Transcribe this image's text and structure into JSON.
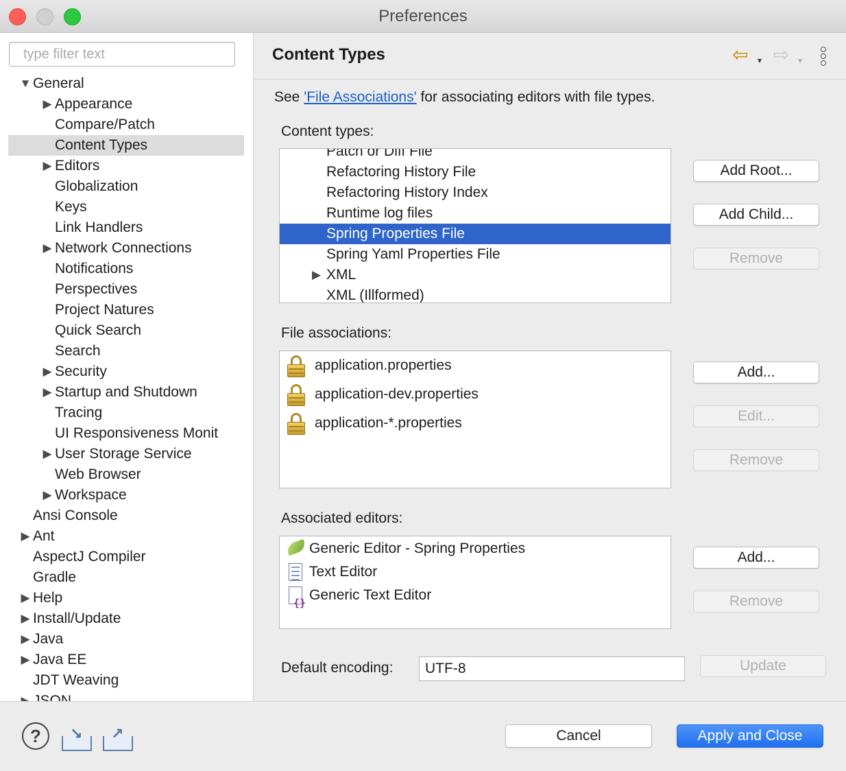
{
  "window": {
    "title": "Preferences"
  },
  "sidebar": {
    "filter_placeholder": "type filter text",
    "items": [
      {
        "label": "General",
        "level": 0,
        "twisty": "▼"
      },
      {
        "label": "Appearance",
        "level": 1,
        "twisty": "▶"
      },
      {
        "label": "Compare/Patch",
        "level": 1,
        "twisty": ""
      },
      {
        "label": "Content Types",
        "level": 1,
        "twisty": "",
        "selected": true
      },
      {
        "label": "Editors",
        "level": 1,
        "twisty": "▶"
      },
      {
        "label": "Globalization",
        "level": 1,
        "twisty": ""
      },
      {
        "label": "Keys",
        "level": 1,
        "twisty": ""
      },
      {
        "label": "Link Handlers",
        "level": 1,
        "twisty": ""
      },
      {
        "label": "Network Connections",
        "level": 1,
        "twisty": "▶"
      },
      {
        "label": "Notifications",
        "level": 1,
        "twisty": ""
      },
      {
        "label": "Perspectives",
        "level": 1,
        "twisty": ""
      },
      {
        "label": "Project Natures",
        "level": 1,
        "twisty": ""
      },
      {
        "label": "Quick Search",
        "level": 1,
        "twisty": ""
      },
      {
        "label": "Search",
        "level": 1,
        "twisty": ""
      },
      {
        "label": "Security",
        "level": 1,
        "twisty": "▶"
      },
      {
        "label": "Startup and Shutdown",
        "level": 1,
        "twisty": "▶"
      },
      {
        "label": "Tracing",
        "level": 1,
        "twisty": ""
      },
      {
        "label": "UI Responsiveness Monit",
        "level": 1,
        "twisty": ""
      },
      {
        "label": "User Storage Service",
        "level": 1,
        "twisty": "▶"
      },
      {
        "label": "Web Browser",
        "level": 1,
        "twisty": ""
      },
      {
        "label": "Workspace",
        "level": 1,
        "twisty": "▶"
      },
      {
        "label": "Ansi Console",
        "level": 0,
        "twisty": ""
      },
      {
        "label": "Ant",
        "level": 0,
        "twisty": "▶"
      },
      {
        "label": "AspectJ Compiler",
        "level": 0,
        "twisty": ""
      },
      {
        "label": "Gradle",
        "level": 0,
        "twisty": ""
      },
      {
        "label": "Help",
        "level": 0,
        "twisty": "▶"
      },
      {
        "label": "Install/Update",
        "level": 0,
        "twisty": "▶"
      },
      {
        "label": "Java",
        "level": 0,
        "twisty": "▶"
      },
      {
        "label": "Java EE",
        "level": 0,
        "twisty": "▶"
      },
      {
        "label": "JDT Weaving",
        "level": 0,
        "twisty": ""
      },
      {
        "label": "JSON",
        "level": 0,
        "twisty": "▶"
      }
    ]
  },
  "content": {
    "title": "Content Types",
    "nav": {
      "back_icon": "back-arrow-icon",
      "forward_icon": "forward-arrow-icon",
      "dropdown": "▾",
      "back_glyph": "⇦",
      "forward_glyph": "⇨"
    },
    "intro": {
      "before": "See ",
      "link": "'File Associations'",
      "after": " for associating editors with file types."
    },
    "content_types": {
      "label": "Content types:",
      "items": [
        {
          "label": "Patch or Diff File",
          "twisty": ""
        },
        {
          "label": "Refactoring History File",
          "twisty": ""
        },
        {
          "label": "Refactoring History Index",
          "twisty": ""
        },
        {
          "label": "Runtime log files",
          "twisty": ""
        },
        {
          "label": "Spring Properties File",
          "twisty": "",
          "selected": true
        },
        {
          "label": "Spring Yaml Properties File",
          "twisty": ""
        },
        {
          "label": "XML",
          "twisty": "▶"
        },
        {
          "label": "XML (Illformed)",
          "twisty": ""
        }
      ],
      "buttons": {
        "add_root": "Add Root...",
        "add_child": "Add Child...",
        "remove": "Remove"
      }
    },
    "file_associations": {
      "label": "File associations:",
      "items": [
        {
          "label": "application.properties",
          "icon": "lock-icon"
        },
        {
          "label": "application-dev.properties",
          "icon": "lock-icon"
        },
        {
          "label": "application-*.properties",
          "icon": "lock-icon"
        }
      ],
      "buttons": {
        "add": "Add...",
        "edit": "Edit...",
        "remove": "Remove"
      }
    },
    "associated_editors": {
      "label": "Associated editors:",
      "items": [
        {
          "label": "Generic Editor - Spring Properties",
          "icon": "spring-leaf-icon"
        },
        {
          "label": "Text Editor",
          "icon": "text-document-icon"
        },
        {
          "label": "Generic Text Editor",
          "icon": "generic-editor-braces-icon"
        }
      ],
      "buttons": {
        "add": "Add...",
        "remove": "Remove"
      }
    },
    "encoding": {
      "label": "Default encoding:",
      "value": "UTF-8",
      "update": "Update"
    }
  },
  "footer": {
    "cancel": "Cancel",
    "apply_close": "Apply and Close",
    "help_glyph": "?",
    "import_glyph": "↘",
    "export_glyph": "↗"
  },
  "colors": {
    "selection": "#2f65ca",
    "primary_button": "#1f6ff0",
    "link": "#1a5fcc",
    "sidebar_selection": "#dcdcdc"
  }
}
